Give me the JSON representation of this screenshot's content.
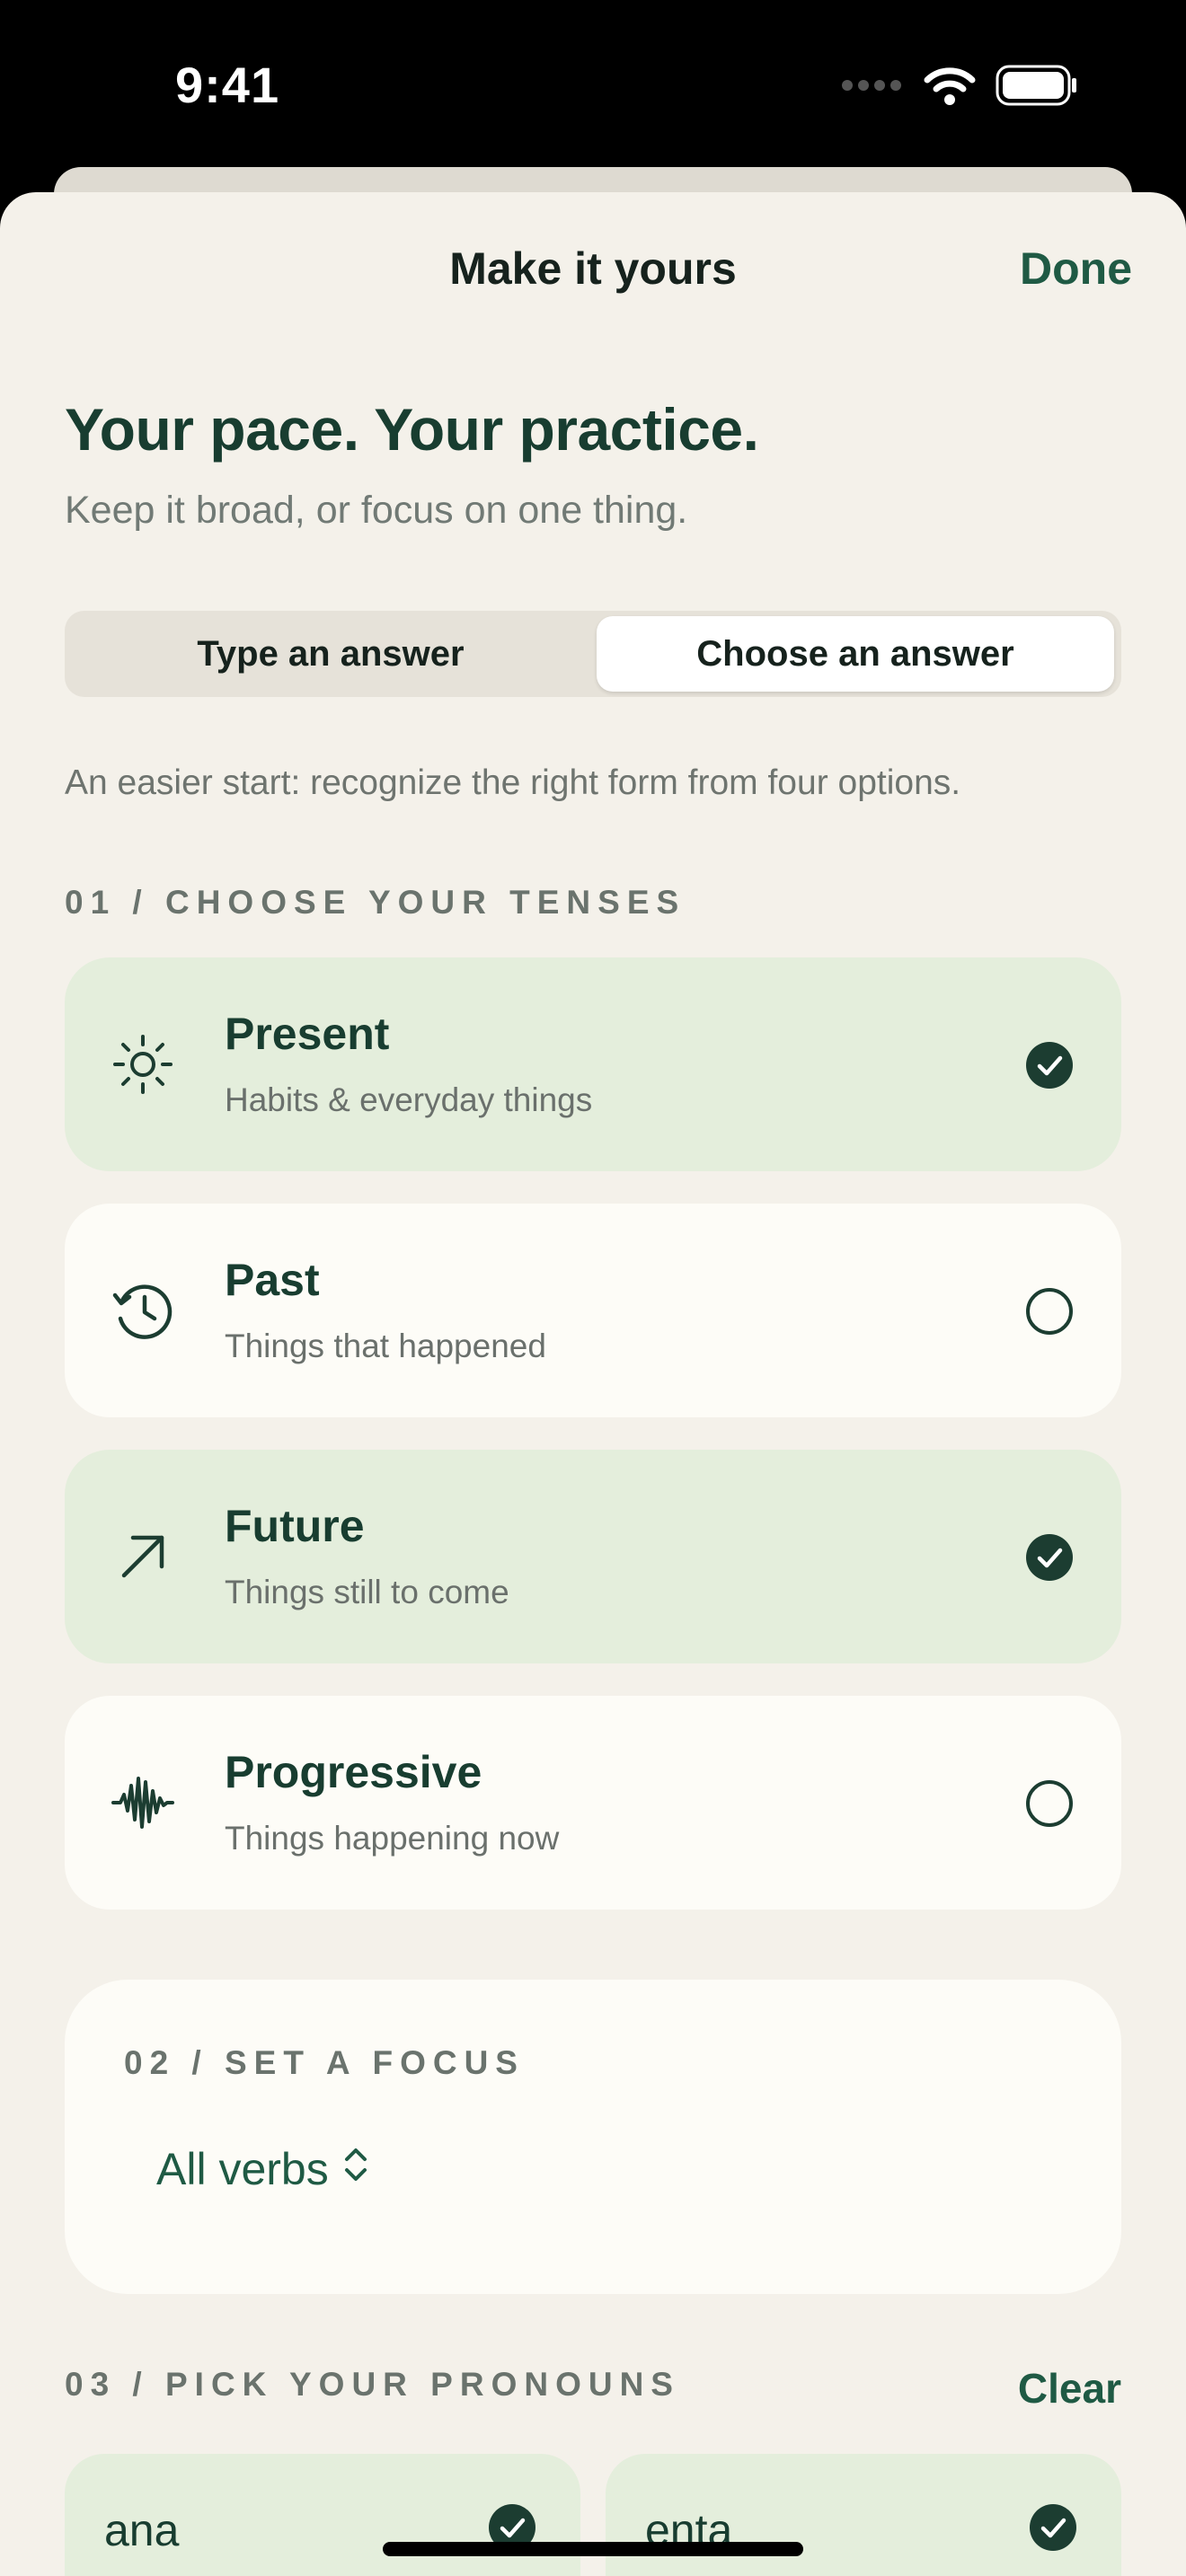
{
  "status": {
    "time": "9:41",
    "icons": [
      "cellular-signal-icon",
      "wifi-icon",
      "battery-icon"
    ]
  },
  "nav": {
    "title": "Make it yours",
    "done_label": "Done"
  },
  "intro": {
    "headline": "Your pace. Your practice.",
    "subheading": "Keep it broad, or focus on one thing."
  },
  "answer_mode": {
    "options": [
      "Type an answer",
      "Choose an answer"
    ],
    "selected": "Choose an answer",
    "hint": "An easier start: recognize the right form from four options."
  },
  "tenses": {
    "label": "01 / CHOOSE YOUR TENSES",
    "items": [
      {
        "title": "Present",
        "description": "Habits & everyday things",
        "icon": "sun-icon",
        "selected": true
      },
      {
        "title": "Past",
        "description": "Things that happened",
        "icon": "history-icon",
        "selected": false
      },
      {
        "title": "Future",
        "description": "Things still to come",
        "icon": "arrow-up-right-icon",
        "selected": true
      },
      {
        "title": "Progressive",
        "description": "Things happening now",
        "icon": "waveform-icon",
        "selected": false
      }
    ]
  },
  "focus": {
    "label": "02 / SET A FOCUS",
    "value": "All verbs"
  },
  "pronouns": {
    "label": "03 / PICK YOUR PRONOUNS",
    "clear_label": "Clear",
    "items": [
      {
        "label": "ana",
        "selected": true
      },
      {
        "label": "enta",
        "selected": true
      }
    ]
  },
  "colors": {
    "accent": "#1f5a44",
    "selected_bg": "#e4eedc",
    "card_bg": "#fdfcf7",
    "sheet_bg": "#f4f1ea"
  }
}
